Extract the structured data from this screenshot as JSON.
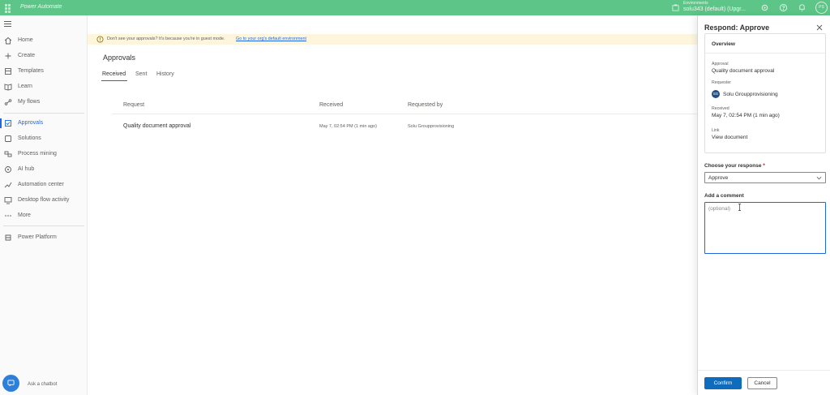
{
  "colors": {
    "topbar": "#5cc587",
    "accent": "#2266e3",
    "primary_button": "#0f6cbd",
    "banner": "#fdf6dd",
    "avatar": "#1f4f86"
  },
  "topbar": {
    "app_title": "Power Automate",
    "env_label": "Environments",
    "env_name": "solu343 (default) (Upgr...",
    "avatar_initials": "PS",
    "icons": [
      "environment-icon",
      "settings-icon",
      "help-icon",
      "notifications-icon"
    ]
  },
  "nav": {
    "items": [
      {
        "label": "Home",
        "icon": "home-icon"
      },
      {
        "label": "Create",
        "icon": "plus-icon"
      },
      {
        "label": "Templates",
        "icon": "templates-icon"
      },
      {
        "label": "Learn",
        "icon": "book-icon"
      },
      {
        "label": "My flows",
        "icon": "flows-icon"
      },
      {
        "label": "Approvals",
        "icon": "approvals-icon",
        "active": true
      },
      {
        "label": "Solutions",
        "icon": "solutions-icon"
      },
      {
        "label": "Process mining",
        "icon": "process-mining-icon"
      },
      {
        "label": "AI hub",
        "icon": "ai-hub-icon"
      },
      {
        "label": "Automation center",
        "icon": "automation-center-icon"
      },
      {
        "label": "Desktop flow activity",
        "icon": "desktop-flow-icon"
      },
      {
        "label": "More",
        "icon": "more-icon"
      },
      {
        "label": "Power Platform",
        "icon": "power-platform-icon"
      }
    ],
    "chatbot_label": "Ask a chatbot"
  },
  "banner": {
    "text": "Don't see your approvals? It's because you're in guest mode.",
    "link": "Go to your org's default environment"
  },
  "main": {
    "title": "Approvals",
    "tabs": [
      "Received",
      "Sent",
      "History"
    ],
    "columns": [
      "Request",
      "Received",
      "Requested by"
    ],
    "rows": [
      {
        "request": "Quality document approval",
        "received": "May 7, 02:54 PM (1 min ago)",
        "requested_by": "Solu Groupprovisioning"
      }
    ]
  },
  "panel": {
    "title": "Respond: Approve",
    "overview_title": "Overview",
    "approval_label": "Approval",
    "approval_value": "Quality document approval",
    "requester_label": "Requester",
    "requester_initials": "SG",
    "requester_value": "Solu Groupprovisioning",
    "received_label": "Received",
    "received_value": "May 7, 02:54 PM (1 min ago)",
    "link_label": "Link",
    "link_value": "View document",
    "response_label": "Choose your response",
    "response_required": "*",
    "response_value": "Approve",
    "comment_label": "Add a comment",
    "comment_placeholder": "(optional)",
    "confirm_label": "Confirm",
    "cancel_label": "Cancel"
  }
}
